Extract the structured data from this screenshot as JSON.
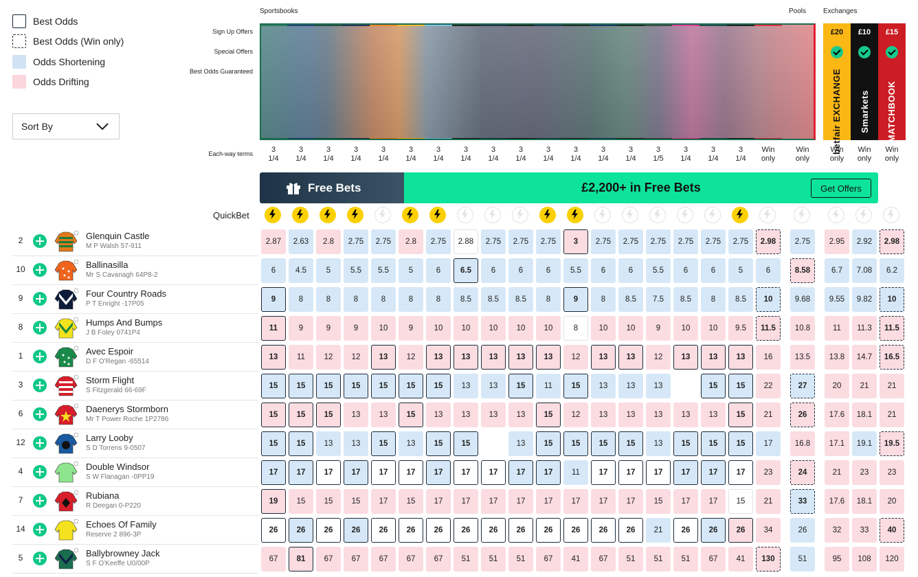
{
  "legend": [
    {
      "label": "Best Odds",
      "style": "best"
    },
    {
      "label": "Best Odds (Win only)",
      "style": "bestwin"
    },
    {
      "label": "Odds Shortening",
      "style": "short"
    },
    {
      "label": "Odds Drifting",
      "style": "drift"
    }
  ],
  "sort": {
    "label": "Sort By"
  },
  "headers": {
    "sportsbooks": "Sportsbooks",
    "pools": "Pools",
    "exchanges": "Exchanges"
  },
  "offer_rows": [
    "Sign Up Offers",
    "Special Offers",
    "Best Odds Guaranteed"
  ],
  "each_way_label": "Each-way terms",
  "each_way": [
    "3\n1/4",
    "3\n1/4",
    "3\n1/4",
    "3\n1/4",
    "3\n1/4",
    "3\n1/4",
    "3\n1/4",
    "3\n1/4",
    "3\n1/4",
    "3\n1/4",
    "3\n1/4",
    "3\n1/4",
    "3\n1/4",
    "3\n1/4",
    "3\n1/5",
    "3\n1/4",
    "3\n1/4",
    "3\n1/4",
    "Win\nonly",
    "Win\nonly",
    "Win\nonly",
    "Win\nonly",
    "Win\nonly"
  ],
  "book_colors": [
    "#1a6e4f",
    "#0f2a6e",
    "#0e3b2d",
    "#13194a",
    "#f07b16",
    "#f5b21e",
    "#6fb7e6",
    "#0b0b0b",
    "#0d1b3a",
    "#0a0a0a",
    "#0d2148",
    "#111111",
    "#0a1f5c",
    "#111111",
    "#333333",
    "#e0288e",
    "#0d3a3a",
    "#0a0a0a",
    "#e0202f"
  ],
  "exchanges": [
    {
      "bonus": "£20",
      "name": "betfair EXCHANGE",
      "bg": "#fbb714",
      "fg": "#111111"
    },
    {
      "bonus": "£10",
      "name": "Smarkets",
      "bg": "#111111",
      "fg": "#ffffff"
    },
    {
      "bonus": "£15",
      "name": "MATCHBOOK",
      "bg": "#cc1d24",
      "fg": "#ffffff"
    }
  ],
  "banner": {
    "left": "Free Bets",
    "center": "£2,200+ in Free Bets",
    "button": "Get Offers"
  },
  "quickbet_label": "QuickBet",
  "quickbet": [
    1,
    1,
    1,
    1,
    0,
    1,
    1,
    0,
    0,
    0,
    1,
    1,
    0,
    0,
    0,
    0,
    0,
    1,
    0,
    0,
    0,
    0,
    0
  ],
  "runners": [
    {
      "num": "2",
      "name": "Glenquin Castle",
      "sub": "M P Walsh 57-911",
      "silk": [
        "#e07a1b",
        "#1b7a3a",
        "stripes"
      ],
      "odds": [
        "2.87",
        "2.63",
        "2.8",
        "2.75",
        "2.75",
        "2.8",
        "2.75",
        "2.88",
        "2.75",
        "2.75",
        "2.75",
        "3",
        "2.75",
        "2.75",
        "2.75",
        "2.75",
        "2.75",
        "2.75",
        "2.98",
        "2.75",
        "2.95",
        "2.92",
        "2.98"
      ],
      "cls": [
        "d",
        "s",
        "d",
        "s",
        "s",
        "d",
        "s",
        "n",
        "s",
        "s",
        "s",
        "db",
        "s",
        "s",
        "s",
        "s",
        "s",
        "s",
        "dw",
        "s",
        "d",
        "s",
        "dw"
      ]
    },
    {
      "num": "10",
      "name": "Ballinasilla",
      "sub": "Mr S Cavanagh 64P8-2",
      "silk": [
        "#f0641c",
        "#ffffff",
        "spots"
      ],
      "odds": [
        "6",
        "4.5",
        "5",
        "5.5",
        "5.5",
        "5",
        "6",
        "6.5",
        "6",
        "6",
        "6",
        "5.5",
        "6",
        "6",
        "5.5",
        "6",
        "6",
        "5",
        "6",
        "8.58",
        "6.7",
        "7.08",
        "6.2"
      ],
      "cls": [
        "s",
        "s",
        "s",
        "s",
        "s",
        "s",
        "s",
        "sb",
        "s",
        "s",
        "s",
        "s",
        "s",
        "s",
        "s",
        "s",
        "s",
        "s",
        "s",
        "dw",
        "s",
        "s",
        "s"
      ]
    },
    {
      "num": "9",
      "name": "Four Country Roads",
      "sub": "P T Enright -17P05",
      "silk": [
        "#0d1b3a",
        "#ffffff",
        "chevron"
      ],
      "odds": [
        "9",
        "8",
        "8",
        "8",
        "8",
        "8",
        "8",
        "8.5",
        "8.5",
        "8.5",
        "8",
        "9",
        "8",
        "8.5",
        "7.5",
        "8.5",
        "8",
        "8.5",
        "10",
        "9.68",
        "9.55",
        "9.82",
        "10"
      ],
      "cls": [
        "sb",
        "s",
        "s",
        "s",
        "s",
        "s",
        "s",
        "s",
        "s",
        "s",
        "s",
        "sb",
        "s",
        "s",
        "s",
        "s",
        "s",
        "s",
        "sw",
        "s",
        "s",
        "s",
        "sw"
      ]
    },
    {
      "num": "8",
      "name": "Humps And Bumps",
      "sub": "J B Foley 0741P4",
      "silk": [
        "#f4e21e",
        "#1a8a3a",
        "chevron"
      ],
      "odds": [
        "11",
        "9",
        "9",
        "9",
        "10",
        "9",
        "10",
        "10",
        "10",
        "10",
        "10",
        "8",
        "10",
        "10",
        "9",
        "10",
        "10",
        "9.5",
        "11.5",
        "10.8",
        "11",
        "11.3",
        "11.5"
      ],
      "cls": [
        "db",
        "d",
        "d",
        "d",
        "d",
        "d",
        "d",
        "d",
        "d",
        "d",
        "d",
        "n",
        "d",
        "d",
        "d",
        "d",
        "d",
        "d",
        "dw",
        "d",
        "d",
        "d",
        "dw"
      ]
    },
    {
      "num": "1",
      "name": "Avec Espoir",
      "sub": "D F O'Regan -65514",
      "silk": [
        "#1a8a4a",
        "#ffffff",
        "spots"
      ],
      "odds": [
        "13",
        "11",
        "12",
        "12",
        "13",
        "12",
        "13",
        "13",
        "13",
        "13",
        "13",
        "12",
        "13",
        "13",
        "12",
        "13",
        "13",
        "13",
        "16",
        "13.5",
        "13.8",
        "14.7",
        "16.5"
      ],
      "cls": [
        "db",
        "d",
        "d",
        "d",
        "db",
        "d",
        "db",
        "db",
        "db",
        "db",
        "db",
        "d",
        "db",
        "db",
        "d",
        "db",
        "db",
        "db",
        "d",
        "d",
        "d",
        "d",
        "dw"
      ]
    },
    {
      "num": "3",
      "name": "Storm Flight",
      "sub": "S Fitzgerald 66-69F",
      "silk": [
        "#d81e2a",
        "#ffffff",
        "hoops"
      ],
      "odds": [
        "15",
        "15",
        "15",
        "15",
        "15",
        "15",
        "15",
        "13",
        "13",
        "15",
        "11",
        "15",
        "13",
        "13",
        "13",
        "15",
        "15",
        "22",
        "27",
        "20",
        "21",
        "21"
      ],
      "cls": [
        "sb",
        "sb",
        "sb",
        "sb",
        "sb",
        "sb",
        "sb",
        "s",
        "s",
        "sb",
        "s",
        "sb",
        "s",
        "s",
        "s",
        "sb",
        "sb",
        "d",
        "sw",
        "d",
        "d",
        "d"
      ],
      "skip": [
        15
      ]
    },
    {
      "num": "6",
      "name": "Daenerys Stormborn",
      "sub": "Mr T Power Roche 1P2786",
      "silk": [
        "#d81e2a",
        "#f4e21e",
        "star"
      ],
      "odds": [
        "15",
        "15",
        "15",
        "13",
        "13",
        "15",
        "13",
        "13",
        "13",
        "13",
        "15",
        "12",
        "13",
        "13",
        "13",
        "13",
        "13",
        "15",
        "21",
        "26",
        "17.6",
        "18.1",
        "21"
      ],
      "cls": [
        "db",
        "db",
        "db",
        "d",
        "d",
        "db",
        "d",
        "d",
        "d",
        "d",
        "db",
        "d",
        "d",
        "d",
        "d",
        "d",
        "d",
        "db",
        "d",
        "dw",
        "d",
        "d",
        "d"
      ]
    },
    {
      "num": "12",
      "name": "Larry Looby",
      "sub": "S D Torrens 9-0507",
      "silk": [
        "#1a5aa0",
        "#111111",
        "ball"
      ],
      "odds": [
        "15",
        "15",
        "13",
        "13",
        "15",
        "13",
        "15",
        "15",
        "13",
        "15",
        "15",
        "15",
        "15",
        "13",
        "15",
        "15",
        "15",
        "17",
        "16.8",
        "17.1",
        "19.1",
        "19.5"
      ],
      "cls": [
        "sb",
        "sb",
        "s",
        "s",
        "sb",
        "s",
        "sb",
        "sb",
        "s",
        "sb",
        "sb",
        "sb",
        "sb",
        "s",
        "sb",
        "sb",
        "sb",
        "s",
        "d",
        "d",
        "s",
        "dw"
      ],
      "skip": [
        8
      ]
    },
    {
      "num": "4",
      "name": "Double Windsor",
      "sub": "S W Flanagan -0PP19",
      "silk": [
        "#8de58d",
        "#8de58d",
        "plain"
      ],
      "odds": [
        "17",
        "17",
        "17",
        "17",
        "17",
        "17",
        "17",
        "17",
        "17",
        "17",
        "17",
        "11",
        "17",
        "17",
        "17",
        "17",
        "17",
        "17",
        "23",
        "24",
        "21",
        "23",
        "23"
      ],
      "cls": [
        "sb",
        "sb",
        "nb",
        "sb",
        "nb",
        "nb",
        "sb",
        "nb",
        "nb",
        "sb",
        "sb",
        "s",
        "nb",
        "nb",
        "nb",
        "sb",
        "sb",
        "nb",
        "d",
        "dw",
        "d",
        "d",
        "d"
      ]
    },
    {
      "num": "7",
      "name": "Rubiana",
      "sub": "R Deegan 0-P220",
      "silk": [
        "#d81e2a",
        "#111111",
        "diamond"
      ],
      "odds": [
        "19",
        "15",
        "15",
        "15",
        "17",
        "15",
        "17",
        "17",
        "17",
        "17",
        "17",
        "17",
        "17",
        "17",
        "15",
        "17",
        "17",
        "15",
        "21",
        "33",
        "17.6",
        "18.1",
        "20"
      ],
      "cls": [
        "db",
        "d",
        "d",
        "d",
        "d",
        "d",
        "d",
        "d",
        "d",
        "d",
        "d",
        "d",
        "d",
        "d",
        "d",
        "d",
        "d",
        "n",
        "d",
        "sw",
        "d",
        "d",
        "d"
      ]
    },
    {
      "num": "14",
      "name": "Echoes Of Family",
      "sub": "Reserve 2 896-3P",
      "silk": [
        "#f4e21e",
        "#f4e21e",
        "plain"
      ],
      "odds": [
        "26",
        "26",
        "26",
        "26",
        "26",
        "26",
        "26",
        "26",
        "26",
        "26",
        "26",
        "26",
        "26",
        "26",
        "21",
        "26",
        "26",
        "26",
        "34",
        "26",
        "32",
        "33",
        "40"
      ],
      "cls": [
        "nb",
        "sb",
        "nb",
        "sb",
        "nb",
        "nb",
        "nb",
        "nb",
        "nb",
        "nb",
        "nb",
        "nb",
        "nb",
        "nb",
        "s",
        "nb",
        "sb",
        "db",
        "d",
        "s",
        "d",
        "d",
        "dw"
      ]
    },
    {
      "num": "5",
      "name": "Ballybrowney Jack",
      "sub": "S F O'Keeffe U0/00P",
      "silk": [
        "#1a6e4f",
        "#0d2148",
        "chevron"
      ],
      "odds": [
        "67",
        "81",
        "67",
        "67",
        "67",
        "67",
        "67",
        "51",
        "51",
        "51",
        "67",
        "41",
        "67",
        "51",
        "51",
        "51",
        "67",
        "41",
        "130",
        "51",
        "95",
        "108",
        "120"
      ],
      "cls": [
        "d",
        "db",
        "d",
        "d",
        "d",
        "d",
        "d",
        "d",
        "d",
        "d",
        "d",
        "d",
        "d",
        "d",
        "d",
        "d",
        "d",
        "d",
        "dw",
        "s",
        "d",
        "d",
        "d"
      ]
    }
  ]
}
